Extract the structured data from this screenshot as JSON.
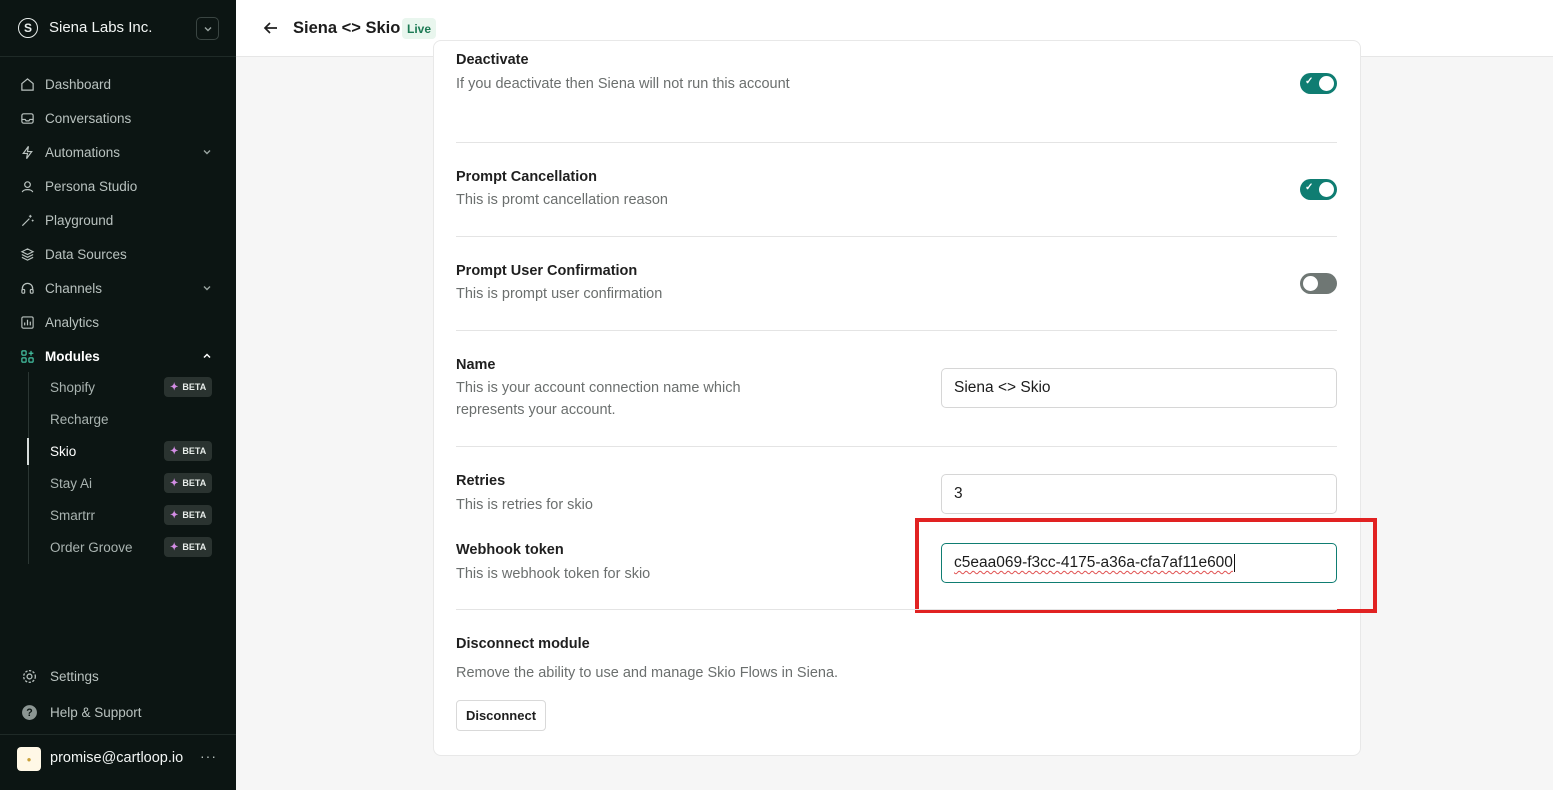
{
  "org": {
    "name": "Siena Labs Inc.",
    "logo_letter": "S"
  },
  "nav": {
    "items": [
      {
        "label": "Dashboard",
        "icon": "home-icon"
      },
      {
        "label": "Conversations",
        "icon": "inbox-icon"
      },
      {
        "label": "Automations",
        "icon": "bolt-icon"
      },
      {
        "label": "Persona Studio",
        "icon": "persona-icon"
      },
      {
        "label": "Playground",
        "icon": "wand-icon"
      },
      {
        "label": "Data Sources",
        "icon": "database-icon"
      },
      {
        "label": "Channels",
        "icon": "headset-icon"
      },
      {
        "label": "Analytics",
        "icon": "chart-icon"
      },
      {
        "label": "Modules",
        "icon": "modules-icon"
      }
    ],
    "modules": [
      {
        "label": "Shopify",
        "badge": "BETA"
      },
      {
        "label": "Recharge"
      },
      {
        "label": "Skio",
        "badge": "BETA"
      },
      {
        "label": "Stay Ai",
        "badge": "BETA"
      },
      {
        "label": "Smartrr",
        "badge": "BETA"
      },
      {
        "label": "Order Groove",
        "badge": "BETA"
      }
    ],
    "settings": "Settings",
    "help": "Help & Support"
  },
  "user": {
    "email": "promise@cartloop.io",
    "more": "···"
  },
  "header": {
    "title": "Siena <> Skio",
    "status": "Live"
  },
  "settings": {
    "deactivate": {
      "title": "Deactivate",
      "desc": "If you deactivate then Siena will not run this account",
      "enabled": true
    },
    "prompt_cancellation": {
      "title": "Prompt Cancellation",
      "desc": "This is promt cancellation reason",
      "enabled": true
    },
    "prompt_user_confirmation": {
      "title": "Prompt User Confirmation",
      "desc": "This is prompt user confirmation",
      "enabled": false
    },
    "name": {
      "title": "Name",
      "desc": "This is your account connection name which represents your account.",
      "value": "Siena <> Skio"
    },
    "retries": {
      "title": "Retries",
      "desc": "This is retries for skio",
      "value": "3"
    },
    "webhook_token": {
      "title": "Webhook token",
      "desc": "This is webhook token for skio",
      "value": "c5eaa069-f3cc-4175-a36a-cfa7af11e600"
    },
    "disconnect": {
      "title": "Disconnect module",
      "desc": "Remove the ability to use and manage Skio Flows in Siena.",
      "button": "Disconnect"
    }
  },
  "colors": {
    "sidebar_bg": "#0c1513",
    "accent": "#0f7d72",
    "highlight": "#e12222",
    "live_badge_text": "#1c7a54"
  }
}
